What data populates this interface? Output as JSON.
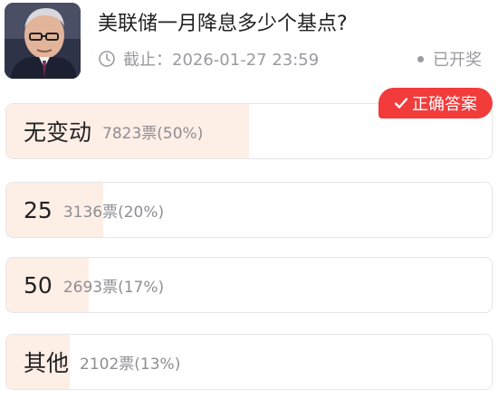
{
  "poll": {
    "title": "美联储一月降息多少个基点?",
    "deadline_text": "截止：2026-01-27 23:59",
    "status_text": "已开奖",
    "correct_badge": "正确答案",
    "options": [
      {
        "label": "无变动",
        "votes": "7823票(50%)",
        "percent": 50,
        "correct": true
      },
      {
        "label": "25",
        "votes": "3136票(20%)",
        "percent": 20,
        "correct": false
      },
      {
        "label": "50",
        "votes": "2693票(17%)",
        "percent": 17,
        "correct": false
      },
      {
        "label": "其他",
        "votes": "2102票(13%)",
        "percent": 13,
        "correct": false
      }
    ]
  },
  "colors": {
    "fill": "#fdeee6",
    "badge": "#f23b3b",
    "muted": "#9a9aa0"
  }
}
